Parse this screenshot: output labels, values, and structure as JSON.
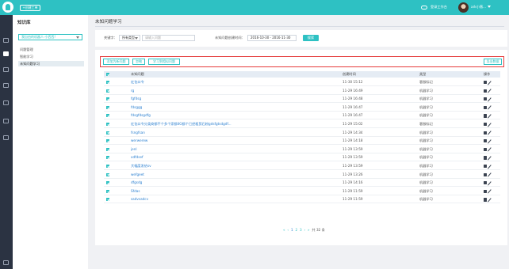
{
  "topbar": {
    "create_btn": "+创建工单",
    "workbench": "登录工作台",
    "user_name": "ark小薇..."
  },
  "sidebar": {
    "title": "知识库",
    "robot_select": "我自由的机器人-小西西!",
    "menu": [
      {
        "label": "问题管理"
      },
      {
        "label": "智能学习"
      },
      {
        "label": "未知问题学习"
      }
    ]
  },
  "main": {
    "page_title": "未知问题学习"
  },
  "filter": {
    "keyword_label": "关键字：",
    "type_select": "所有类型",
    "keyword_placeholder": "请输入问题",
    "time_label": "未知问题创建时间：",
    "date_range": "2016-10-30 - 2016-11-30",
    "search_btn": "搜索"
  },
  "toolbar": {
    "add_btn": "添加为新问题",
    "ignore_btn": "忽略",
    "learn_btn": "学习到相似问题",
    "export_btn": "导出数据"
  },
  "table": {
    "columns": {
      "question": "未知问题",
      "time": "创建时间",
      "type": "类型",
      "action": "操作"
    },
    "rows": [
      {
        "question": "红包口令",
        "time": "11-30 15:12",
        "type": "客服标记"
      },
      {
        "question": "rg",
        "time": "11-29 16:49",
        "type": "机器学习"
      },
      {
        "question": "fgfdsg",
        "time": "11-29 16:48",
        "type": "机器学习"
      },
      {
        "question": "fdsggg",
        "time": "11-29 16:47",
        "type": "机器学习"
      },
      {
        "question": "fdsgfdsgdfg",
        "time": "11-29 16:47",
        "type": "机器学习"
      },
      {
        "question": "红包口令分类商都干个多个家都4G都个已经粗剪石粉gdsfgtsdgdf...",
        "time": "11-29 15:02",
        "type": "客服标记"
      },
      {
        "question": "fsngfsan",
        "time": "11-29 14:34",
        "type": "机器学习"
      },
      {
        "question": "werwerew",
        "time": "11-29 14:18",
        "type": "机器学习"
      },
      {
        "question": "jenl",
        "time": "11-29 13:59",
        "type": "机器学习"
      },
      {
        "question": "xdfdsef",
        "time": "11-29 13:59",
        "type": "机器学习"
      },
      {
        "question": "大幅度发给sv",
        "time": "11-29 13:59",
        "type": "机器学习"
      },
      {
        "question": "wefgeet",
        "time": "11-29 13:26",
        "type": "机器学习"
      },
      {
        "question": "dfgsdg",
        "time": "11-29 14:16",
        "type": "机器学习"
      },
      {
        "question": "Sfdas",
        "time": "11-29 11:59",
        "type": "机器学习"
      },
      {
        "question": "sadvsadcv",
        "time": "11-29 11:59",
        "type": "机器学习"
      }
    ]
  },
  "pagination": {
    "first": "«",
    "prev": "‹",
    "pages": [
      "1",
      "2",
      "3"
    ],
    "next": "›",
    "last": "»",
    "total": "共 32 条"
  }
}
